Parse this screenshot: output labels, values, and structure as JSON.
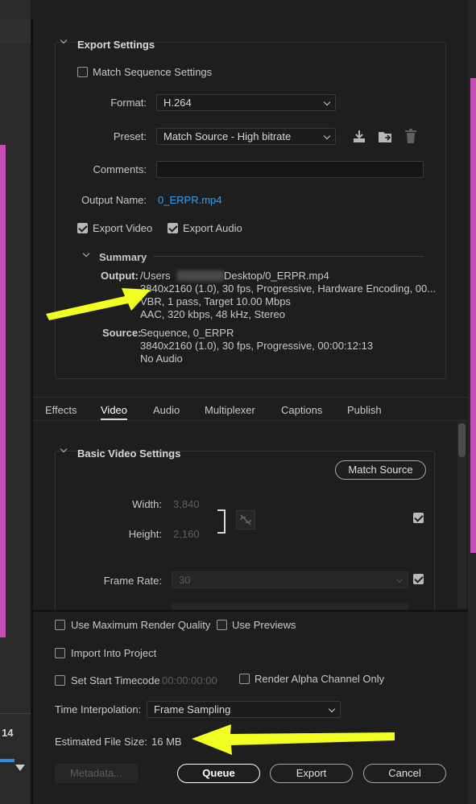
{
  "export_settings": {
    "title": "Export Settings",
    "match_sequence_label": "Match Sequence Settings",
    "format_label": "Format:",
    "format_value": "H.264",
    "preset_label": "Preset:",
    "preset_value": "Match Source - High bitrate",
    "comments_label": "Comments:",
    "output_name_label": "Output Name:",
    "output_name_value": "0_ERPR.mp4",
    "export_video_label": "Export Video",
    "export_audio_label": "Export Audio"
  },
  "summary": {
    "title": "Summary",
    "output_label": "Output:",
    "output_lines": [
      "/Users",
      "Desktop/0_ERPR.mp4",
      "3840x2160 (1.0), 30 fps, Progressive, Hardware Encoding, 00...",
      "VBR, 1 pass, Target 10.00 Mbps",
      "AAC, 320 kbps, 48 kHz, Stereo"
    ],
    "source_label": "Source:",
    "source_lines": [
      "Sequence, 0_ERPR",
      "3840x2160 (1.0), 30 fps, Progressive, 00:00:12:13",
      "No Audio"
    ]
  },
  "tabs": [
    "Effects",
    "Video",
    "Audio",
    "Multiplexer",
    "Captions",
    "Publish"
  ],
  "video": {
    "section_title": "Basic Video Settings",
    "match_source_label": "Match Source",
    "width_label": "Width:",
    "width_value": "3,840",
    "height_label": "Height:",
    "height_value": "2,160",
    "frame_rate_label": "Frame Rate:",
    "frame_rate_value": "30"
  },
  "bottom": {
    "max_render_label": "Use Maximum Render Quality",
    "use_previews_label": "Use Previews",
    "import_label": "Import Into Project",
    "start_timecode_label": "Set Start Timecode",
    "start_timecode_value": "00:00:00:00",
    "render_alpha_label": "Render Alpha Channel Only",
    "time_interp_label": "Time Interpolation:",
    "time_interp_value": "Frame Sampling",
    "file_size_label": "Estimated File Size:",
    "file_size_value": "16 MB",
    "metadata_label": "Metadata...",
    "queue_label": "Queue",
    "export_label": "Export",
    "cancel_label": "Cancel"
  },
  "left_strip": {
    "counter": "14"
  },
  "colors": {
    "magenta": "#c64fb4",
    "annotation_arrow": "#f2fe22",
    "link": "#3a9ee8"
  }
}
